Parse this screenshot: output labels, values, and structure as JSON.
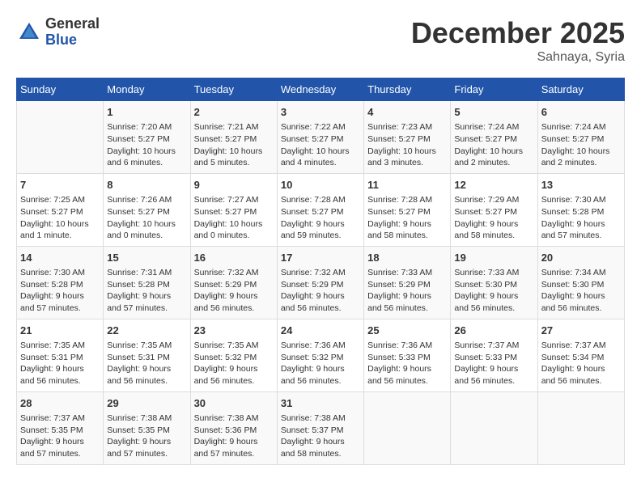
{
  "header": {
    "logo_general": "General",
    "logo_blue": "Blue",
    "month_title": "December 2025",
    "location": "Sahnaya, Syria"
  },
  "weekdays": [
    "Sunday",
    "Monday",
    "Tuesday",
    "Wednesday",
    "Thursday",
    "Friday",
    "Saturday"
  ],
  "weeks": [
    [
      {
        "day": "",
        "info": ""
      },
      {
        "day": "1",
        "info": "Sunrise: 7:20 AM\nSunset: 5:27 PM\nDaylight: 10 hours\nand 6 minutes."
      },
      {
        "day": "2",
        "info": "Sunrise: 7:21 AM\nSunset: 5:27 PM\nDaylight: 10 hours\nand 5 minutes."
      },
      {
        "day": "3",
        "info": "Sunrise: 7:22 AM\nSunset: 5:27 PM\nDaylight: 10 hours\nand 4 minutes."
      },
      {
        "day": "4",
        "info": "Sunrise: 7:23 AM\nSunset: 5:27 PM\nDaylight: 10 hours\nand 3 minutes."
      },
      {
        "day": "5",
        "info": "Sunrise: 7:24 AM\nSunset: 5:27 PM\nDaylight: 10 hours\nand 2 minutes."
      },
      {
        "day": "6",
        "info": "Sunrise: 7:24 AM\nSunset: 5:27 PM\nDaylight: 10 hours\nand 2 minutes."
      }
    ],
    [
      {
        "day": "7",
        "info": "Sunrise: 7:25 AM\nSunset: 5:27 PM\nDaylight: 10 hours\nand 1 minute."
      },
      {
        "day": "8",
        "info": "Sunrise: 7:26 AM\nSunset: 5:27 PM\nDaylight: 10 hours\nand 0 minutes."
      },
      {
        "day": "9",
        "info": "Sunrise: 7:27 AM\nSunset: 5:27 PM\nDaylight: 10 hours\nand 0 minutes."
      },
      {
        "day": "10",
        "info": "Sunrise: 7:28 AM\nSunset: 5:27 PM\nDaylight: 9 hours\nand 59 minutes."
      },
      {
        "day": "11",
        "info": "Sunrise: 7:28 AM\nSunset: 5:27 PM\nDaylight: 9 hours\nand 58 minutes."
      },
      {
        "day": "12",
        "info": "Sunrise: 7:29 AM\nSunset: 5:27 PM\nDaylight: 9 hours\nand 58 minutes."
      },
      {
        "day": "13",
        "info": "Sunrise: 7:30 AM\nSunset: 5:28 PM\nDaylight: 9 hours\nand 57 minutes."
      }
    ],
    [
      {
        "day": "14",
        "info": "Sunrise: 7:30 AM\nSunset: 5:28 PM\nDaylight: 9 hours\nand 57 minutes."
      },
      {
        "day": "15",
        "info": "Sunrise: 7:31 AM\nSunset: 5:28 PM\nDaylight: 9 hours\nand 57 minutes."
      },
      {
        "day": "16",
        "info": "Sunrise: 7:32 AM\nSunset: 5:29 PM\nDaylight: 9 hours\nand 56 minutes."
      },
      {
        "day": "17",
        "info": "Sunrise: 7:32 AM\nSunset: 5:29 PM\nDaylight: 9 hours\nand 56 minutes."
      },
      {
        "day": "18",
        "info": "Sunrise: 7:33 AM\nSunset: 5:29 PM\nDaylight: 9 hours\nand 56 minutes."
      },
      {
        "day": "19",
        "info": "Sunrise: 7:33 AM\nSunset: 5:30 PM\nDaylight: 9 hours\nand 56 minutes."
      },
      {
        "day": "20",
        "info": "Sunrise: 7:34 AM\nSunset: 5:30 PM\nDaylight: 9 hours\nand 56 minutes."
      }
    ],
    [
      {
        "day": "21",
        "info": "Sunrise: 7:35 AM\nSunset: 5:31 PM\nDaylight: 9 hours\nand 56 minutes."
      },
      {
        "day": "22",
        "info": "Sunrise: 7:35 AM\nSunset: 5:31 PM\nDaylight: 9 hours\nand 56 minutes."
      },
      {
        "day": "23",
        "info": "Sunrise: 7:35 AM\nSunset: 5:32 PM\nDaylight: 9 hours\nand 56 minutes."
      },
      {
        "day": "24",
        "info": "Sunrise: 7:36 AM\nSunset: 5:32 PM\nDaylight: 9 hours\nand 56 minutes."
      },
      {
        "day": "25",
        "info": "Sunrise: 7:36 AM\nSunset: 5:33 PM\nDaylight: 9 hours\nand 56 minutes."
      },
      {
        "day": "26",
        "info": "Sunrise: 7:37 AM\nSunset: 5:33 PM\nDaylight: 9 hours\nand 56 minutes."
      },
      {
        "day": "27",
        "info": "Sunrise: 7:37 AM\nSunset: 5:34 PM\nDaylight: 9 hours\nand 56 minutes."
      }
    ],
    [
      {
        "day": "28",
        "info": "Sunrise: 7:37 AM\nSunset: 5:35 PM\nDaylight: 9 hours\nand 57 minutes."
      },
      {
        "day": "29",
        "info": "Sunrise: 7:38 AM\nSunset: 5:35 PM\nDaylight: 9 hours\nand 57 minutes."
      },
      {
        "day": "30",
        "info": "Sunrise: 7:38 AM\nSunset: 5:36 PM\nDaylight: 9 hours\nand 57 minutes."
      },
      {
        "day": "31",
        "info": "Sunrise: 7:38 AM\nSunset: 5:37 PM\nDaylight: 9 hours\nand 58 minutes."
      },
      {
        "day": "",
        "info": ""
      },
      {
        "day": "",
        "info": ""
      },
      {
        "day": "",
        "info": ""
      }
    ]
  ]
}
